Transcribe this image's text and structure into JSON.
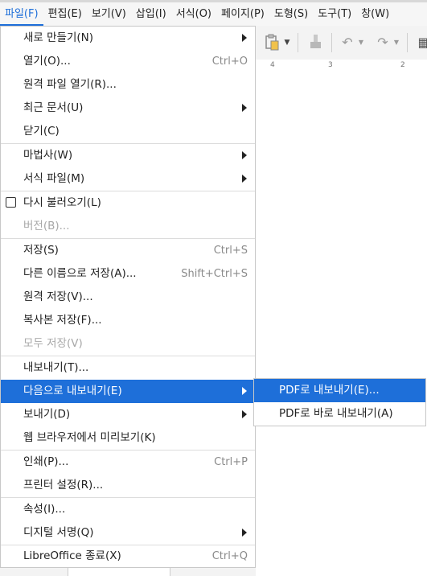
{
  "menubar": {
    "items": [
      {
        "label": "파일(F)"
      },
      {
        "label": "편집(E)"
      },
      {
        "label": "보기(V)"
      },
      {
        "label": "삽입(I)"
      },
      {
        "label": "서식(O)"
      },
      {
        "label": "페이지(P)"
      },
      {
        "label": "도형(S)"
      },
      {
        "label": "도구(T)"
      },
      {
        "label": "창(W)"
      }
    ]
  },
  "toolbar": {
    "paste_icon": "paste-icon",
    "clone_icon": "clone-formatting-icon",
    "undo_icon": "undo-icon",
    "redo_icon": "redo-icon"
  },
  "ruler": {
    "ticks": [
      "4",
      "3",
      "2"
    ]
  },
  "file_menu": {
    "items": [
      {
        "label": "새로 만들기(N)",
        "shortcut": ""
      },
      {
        "label": "열기(O)...",
        "shortcut": "Ctrl+O"
      },
      {
        "label": "원격 파일 열기(R)...",
        "shortcut": ""
      },
      {
        "label": "최근 문서(U)",
        "shortcut": ""
      },
      {
        "label": "닫기(C)",
        "shortcut": ""
      },
      {
        "label": "마법사(W)",
        "shortcut": ""
      },
      {
        "label": "서식 파일(M)",
        "shortcut": ""
      },
      {
        "label": "다시 불러오기(L)",
        "shortcut": ""
      },
      {
        "label": "버전(B)...",
        "shortcut": ""
      },
      {
        "label": "저장(S)",
        "shortcut": "Ctrl+S"
      },
      {
        "label": "다른 이름으로 저장(A)...",
        "shortcut": "Shift+Ctrl+S"
      },
      {
        "label": "원격 저장(V)...",
        "shortcut": ""
      },
      {
        "label": "복사본 저장(F)...",
        "shortcut": ""
      },
      {
        "label": "모두 저장(V)",
        "shortcut": ""
      },
      {
        "label": "내보내기(T)...",
        "shortcut": ""
      },
      {
        "label": "다음으로 내보내기(E)",
        "shortcut": ""
      },
      {
        "label": "보내기(D)",
        "shortcut": ""
      },
      {
        "label": "웹 브라우저에서 미리보기(K)",
        "shortcut": ""
      },
      {
        "label": "인쇄(P)...",
        "shortcut": "Ctrl+P"
      },
      {
        "label": "프린터 설정(R)...",
        "shortcut": ""
      },
      {
        "label": "속성(I)...",
        "shortcut": ""
      },
      {
        "label": "디지털 서명(Q)",
        "shortcut": ""
      },
      {
        "label": "LibreOffice 종료(X)",
        "shortcut": "Ctrl+Q"
      }
    ]
  },
  "export_submenu": {
    "items": [
      {
        "label": "PDF로 내보내기(E)..."
      },
      {
        "label": "PDF로 바로 내보내기(A)"
      }
    ]
  },
  "colors": {
    "highlight": "#1e6fd9",
    "disabled_text": "#a8a8a8",
    "shortcut_text": "#8a8a8a"
  }
}
